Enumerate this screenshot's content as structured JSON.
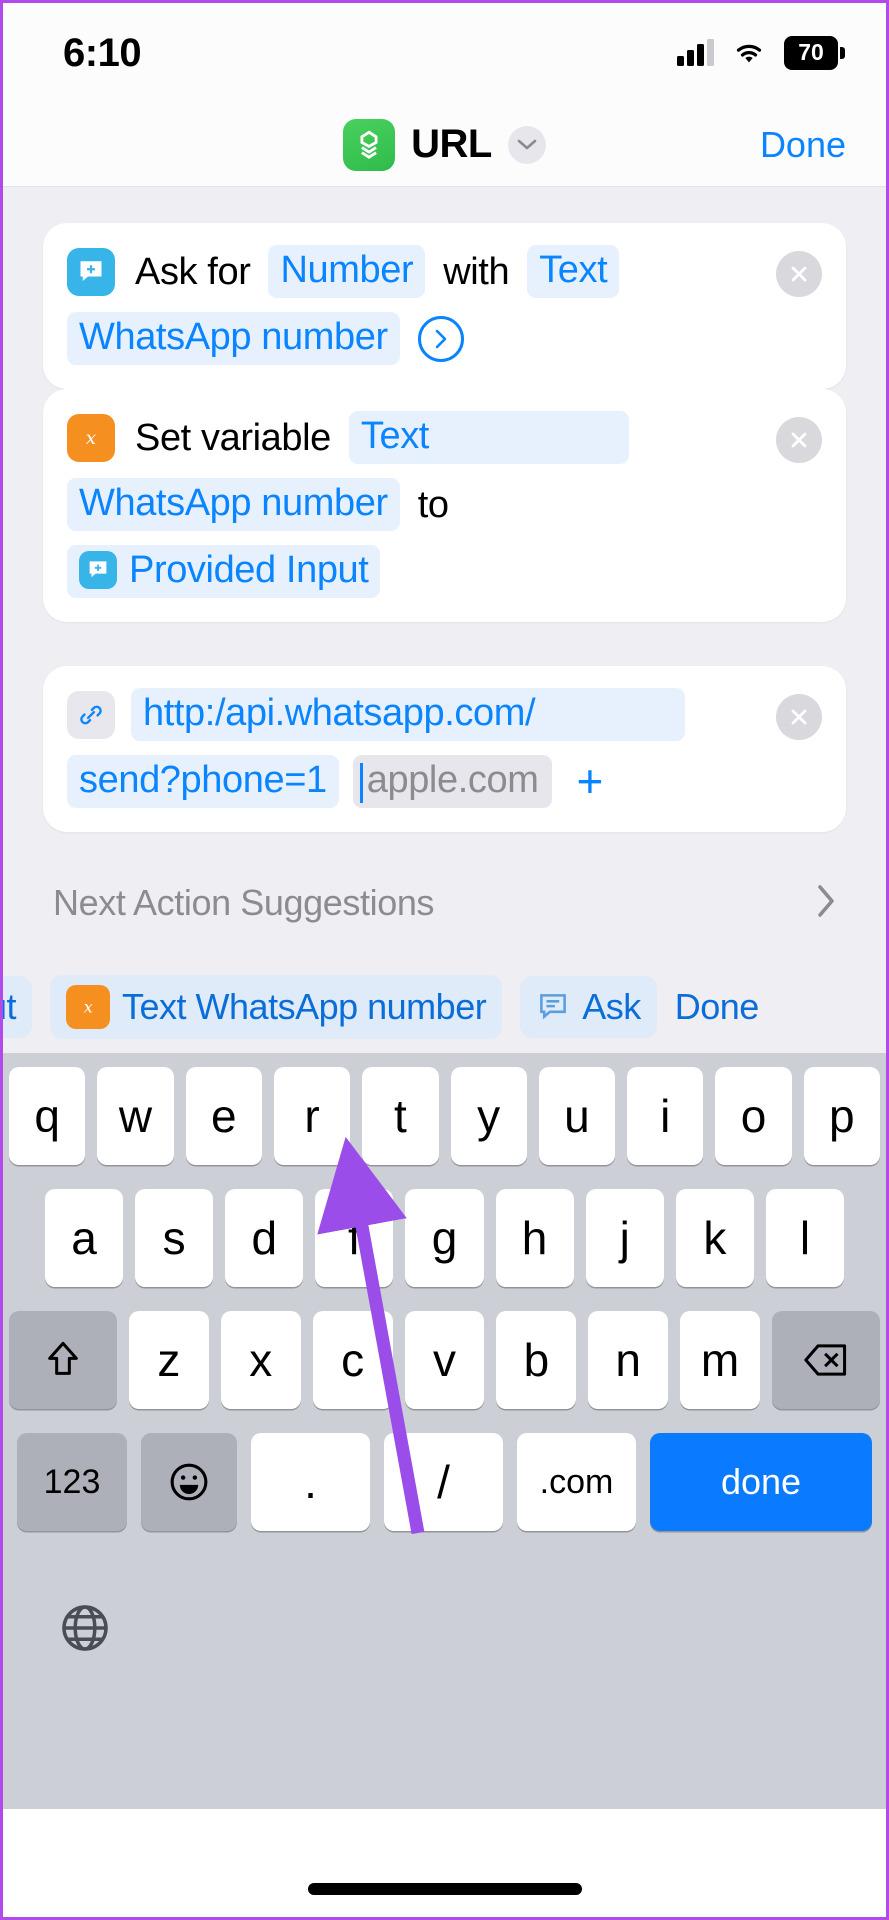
{
  "status_bar": {
    "time": "6:10",
    "battery": "70",
    "cellular_icon": "signal-bars-icon",
    "wifi_icon": "wifi-icon"
  },
  "nav_bar": {
    "app_icon": "shortcuts-app-icon",
    "title": "URL",
    "chevron_icon": "chevron-down-icon",
    "done_label": "Done"
  },
  "actions": [
    {
      "id": "ask-for-input",
      "icon": "ask-for-input-icon",
      "tokens": [
        {
          "type": "text",
          "value": "Ask for"
        },
        {
          "type": "pill",
          "value": "Number"
        },
        {
          "type": "text",
          "value": "with"
        },
        {
          "type": "pill",
          "value": "Text"
        },
        {
          "type": "pill",
          "value": "WhatsApp number"
        }
      ],
      "disclosure_icon": "chevron-right-circle-icon",
      "remove_icon": "close-icon"
    },
    {
      "id": "set-variable",
      "icon": "set-variable-icon",
      "tokens": [
        {
          "type": "text",
          "value": "Set variable"
        },
        {
          "type": "pill",
          "value": "Text"
        },
        {
          "type": "pill",
          "value": "WhatsApp number"
        },
        {
          "type": "text",
          "value": "to"
        },
        {
          "type": "pill",
          "value": "Provided Input",
          "leading_icon": "provided-input-icon"
        }
      ],
      "remove_icon": "close-icon"
    },
    {
      "id": "url",
      "icon": "link-icon",
      "url_line1": "http:/api.whatsapp.com/",
      "url_line2": "send?phone=1",
      "placeholder": "apple.com",
      "add_icon": "plus-icon",
      "remove_icon": "close-icon"
    }
  ],
  "suggestions": {
    "label": "Next Action Suggestions",
    "chevron_icon": "chevron-right-icon"
  },
  "variable_bar": {
    "clipped_chip": "ut",
    "chip_icon": "set-variable-icon",
    "chip_label": "Text WhatsApp number",
    "ask_icon": "ask-for-input-icon",
    "ask_label": "Ask",
    "done_label": "Done"
  },
  "keyboard": {
    "row1": [
      "q",
      "w",
      "e",
      "r",
      "t",
      "y",
      "u",
      "i",
      "o",
      "p"
    ],
    "row2": [
      "a",
      "s",
      "d",
      "f",
      "g",
      "h",
      "j",
      "k",
      "l"
    ],
    "row3_shift_icon": "shift-icon",
    "row3": [
      "z",
      "x",
      "c",
      "v",
      "b",
      "n",
      "m"
    ],
    "row3_backspace_icon": "backspace-icon",
    "numbers_key": "123",
    "emoji_icon": "emoji-icon",
    "dot_key": ".",
    "slash_key": "/",
    "com_key": ".com",
    "done_key": "done",
    "globe_icon": "globe-icon"
  },
  "colors": {
    "accent_blue": "#0a84ff",
    "pill_blue_bg": "#e7f1fd",
    "ask_icon_bg": "#37b4e8",
    "variable_icon_bg": "#f59020",
    "app_green": "#34c759",
    "annotation_purple": "#9b4dea",
    "keyboard_bg": "#cdcfd6"
  }
}
